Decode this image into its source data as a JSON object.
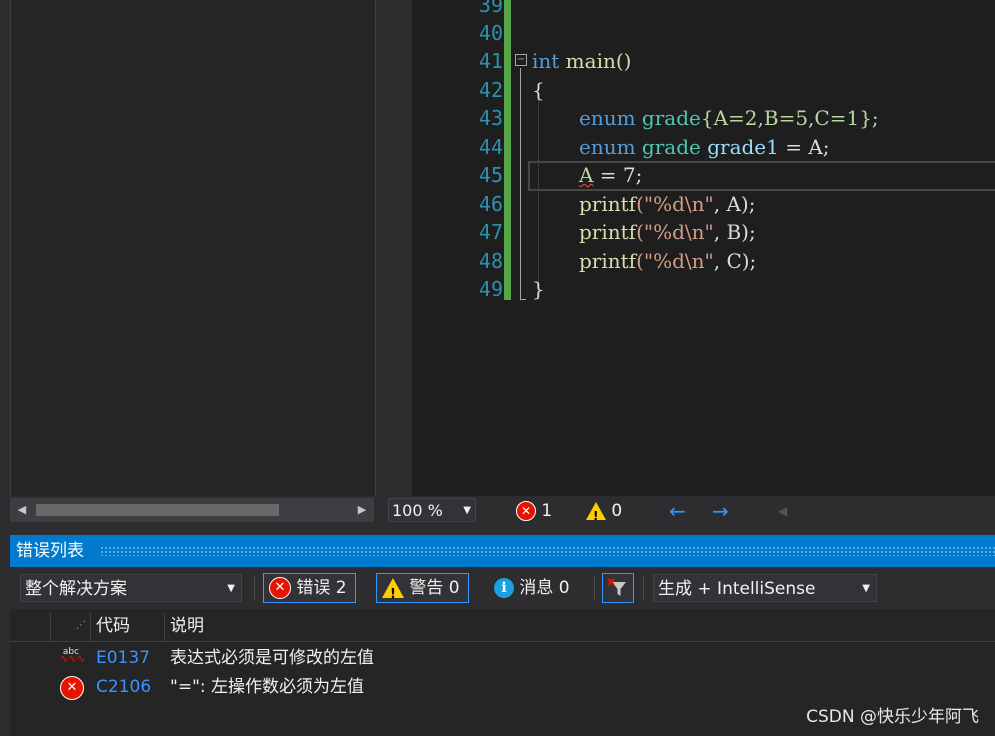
{
  "editor": {
    "lines": [
      {
        "num": "39"
      },
      {
        "num": "40"
      },
      {
        "num": "41"
      },
      {
        "num": "42"
      },
      {
        "num": "43"
      },
      {
        "num": "44"
      },
      {
        "num": "45"
      },
      {
        "num": "46"
      },
      {
        "num": "47"
      },
      {
        "num": "48"
      },
      {
        "num": "49"
      }
    ],
    "code": {
      "l41_kw": "int",
      "l41_fn": " main()",
      "l42": "{",
      "l43_kw": "enum",
      "l43_ty": " grade",
      "l43_rest": "{A=2,B=5,C=1};",
      "l44_kw": "enum",
      "l44_ty": " grade",
      "l44_var": " grade1",
      "l44_rest": " = A;",
      "l45_a": "A",
      "l45_rest": " = 7;",
      "l46_fn": "printf",
      "l46_str": "(\"%d\\n\"",
      "l46_rest": ", A);",
      "l47_fn": "printf",
      "l47_str": "(\"%d\\n\"",
      "l47_rest": ", B);",
      "l48_fn": "printf",
      "l48_str": "(\"%d\\n\"",
      "l48_rest": ", C);",
      "l49": "}"
    },
    "collapse_symbol": "−"
  },
  "status": {
    "zoom": "100 %",
    "error_count": "1",
    "warning_count": "0"
  },
  "error_list": {
    "title": "错误列表",
    "scope": "整个解决方案",
    "errors_btn": "错误 2",
    "warnings_btn": "警告 0",
    "messages_btn": "消息 0",
    "build_filter": "生成 + IntelliSense",
    "columns": {
      "code": "代码",
      "description": "说明"
    },
    "rows": [
      {
        "code": "E0137",
        "description": "表达式必须是可修改的左值",
        "icon": "intellisense-error-icon"
      },
      {
        "code": "C2106",
        "description": "\"=\": 左操作数必须为左值",
        "icon": "error-icon"
      }
    ]
  },
  "watermark": "CSDN @快乐少年阿飞"
}
